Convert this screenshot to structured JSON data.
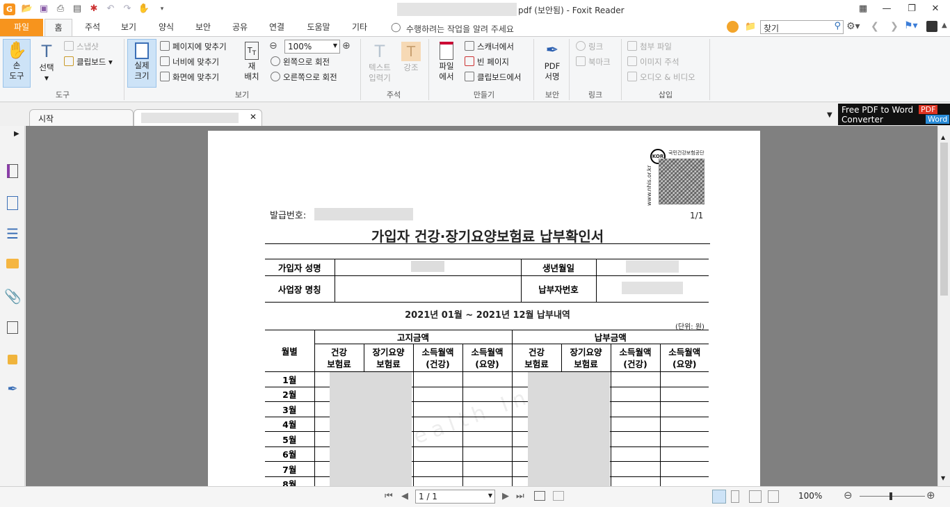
{
  "window": {
    "title_suffix": "pdf (보안됨) - Foxit Reader"
  },
  "menu": {
    "tabs": [
      "파일",
      "홈",
      "주석",
      "보기",
      "양식",
      "보안",
      "공유",
      "연결",
      "도움말",
      "기타"
    ],
    "tell_me": "수행하려는 작업을 알려 주세요",
    "search_placeholder": "찾기"
  },
  "ribbon": {
    "hand": "손\n도구",
    "select": "선택",
    "snapshot": "스냅샷",
    "clipboard": "클립보드",
    "group_tools": "도구",
    "actual_size": "실제\n크기",
    "fit_page": "페이지에 맞추기",
    "fit_width": "너비에 맞추기",
    "fit_visible": "화면에 맞추기",
    "reflow": "재\n배치",
    "zoom_value": "100%",
    "rotate_left": "왼쪽으로 회전",
    "rotate_right": "오른쪽으로 회전",
    "group_view": "보기",
    "typewriter": "텍스트\n입력기",
    "highlight": "강조",
    "group_comment": "주석",
    "from_file": "파일\n에서",
    "from_scanner": "스캐너에서",
    "blank_page": "빈 페이지",
    "from_clipboard": "클립보드에서",
    "group_create": "만들기",
    "pdf_sign": "PDF\n서명",
    "group_protect": "보안",
    "link": "링크",
    "bookmark": "북마크",
    "group_links": "링크",
    "attach_file": "첨부 파일",
    "image_annot": "이미지 주석",
    "audio_video": "오디오 & 비디오",
    "group_insert": "삽입"
  },
  "tabs": {
    "start": "시작"
  },
  "ad": {
    "line1": "Free PDF to Word",
    "line2": "Converter",
    "badge1": "PDF",
    "badge2": "Word"
  },
  "document": {
    "issue_no_label": "발급번호:",
    "page_no": "1/1",
    "title": "가입자 건강·장기요양보험료 납부확인서",
    "org_name": "국민건강보험공단",
    "org_url": "www.nhis.or.kr",
    "kor_badge": "KOR",
    "name_label": "가입자 성명",
    "birth_label": "생년월일",
    "workplace_label": "사업장 명칭",
    "payer_no_label": "납부자번호",
    "period": "2021년 01월 ~ 2021년 12월 납부내역",
    "unit": "(단위: 원)",
    "month_col": "월별",
    "notice_group": "고지금액",
    "paid_group": "납부금액",
    "sub_cols": [
      "건강\n보험료",
      "장기요양\n보험료",
      "소득월액\n(건강)",
      "소득월액\n(요양)"
    ],
    "months": [
      "1월",
      "2월",
      "3월",
      "4월",
      "5월",
      "6월",
      "7월",
      "8월"
    ],
    "watermark": "ealth Insu"
  },
  "status": {
    "page": "1 / 1",
    "zoom": "100%"
  }
}
